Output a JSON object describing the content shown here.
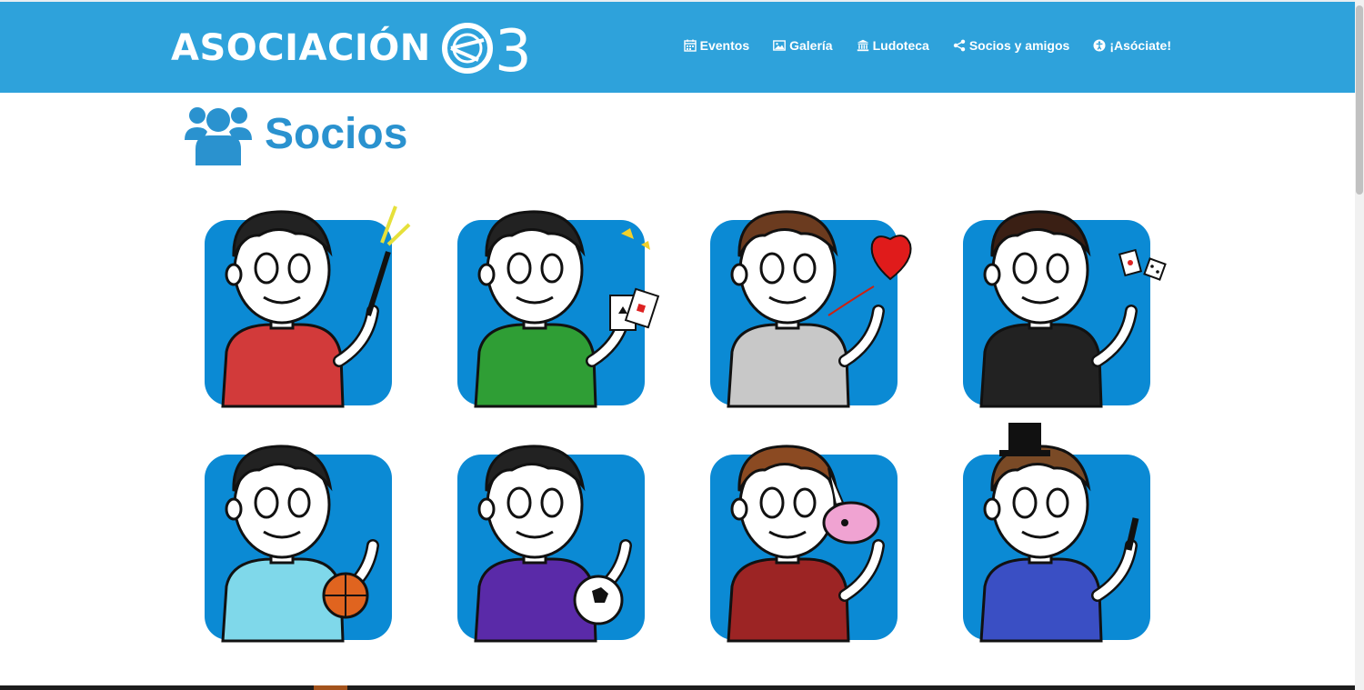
{
  "header": {
    "brand_text": "ASOCIACIÓN",
    "brand_number": "3",
    "colors": {
      "bar": "#2ea2db",
      "text": "#ffffff"
    }
  },
  "nav": {
    "items": [
      {
        "label": "Eventos",
        "icon": "calendar-icon"
      },
      {
        "label": "Galería",
        "icon": "image-icon"
      },
      {
        "label": "Ludoteca",
        "icon": "bank-icon"
      },
      {
        "label": "Socios y amigos",
        "icon": "share-icon"
      },
      {
        "label": "¡Asóciate!",
        "icon": "accessibility-icon"
      }
    ]
  },
  "page": {
    "title": "Socios",
    "title_icon": "users-icon",
    "accent": "#2a92cf"
  },
  "members": {
    "card_color": "#0b8ad4",
    "items": [
      {
        "shirt": "#d23a3a",
        "hair": "#222222",
        "prop": "magic-wand-icon"
      },
      {
        "shirt": "#2f9e35",
        "hair": "#222222",
        "prop": "playing-cards-icon"
      },
      {
        "shirt": "#c8c8c8",
        "hair": "#6b3b1f",
        "prop": "heart-icon"
      },
      {
        "shirt": "#222222",
        "hair": "#3a1f14",
        "prop": "cards-dice-icon"
      },
      {
        "shirt": "#7fd8ea",
        "hair": "#222222",
        "prop": "basketball-icon"
      },
      {
        "shirt": "#5a2aa8",
        "hair": "#222222",
        "prop": "soccer-ball-icon"
      },
      {
        "shirt": "#9c2424",
        "hair": "#8b4a22",
        "prop": "unicorn-icon"
      },
      {
        "shirt": "#3a4fc4",
        "hair": "#7a4a26",
        "prop": "top-hat-icon"
      }
    ]
  }
}
